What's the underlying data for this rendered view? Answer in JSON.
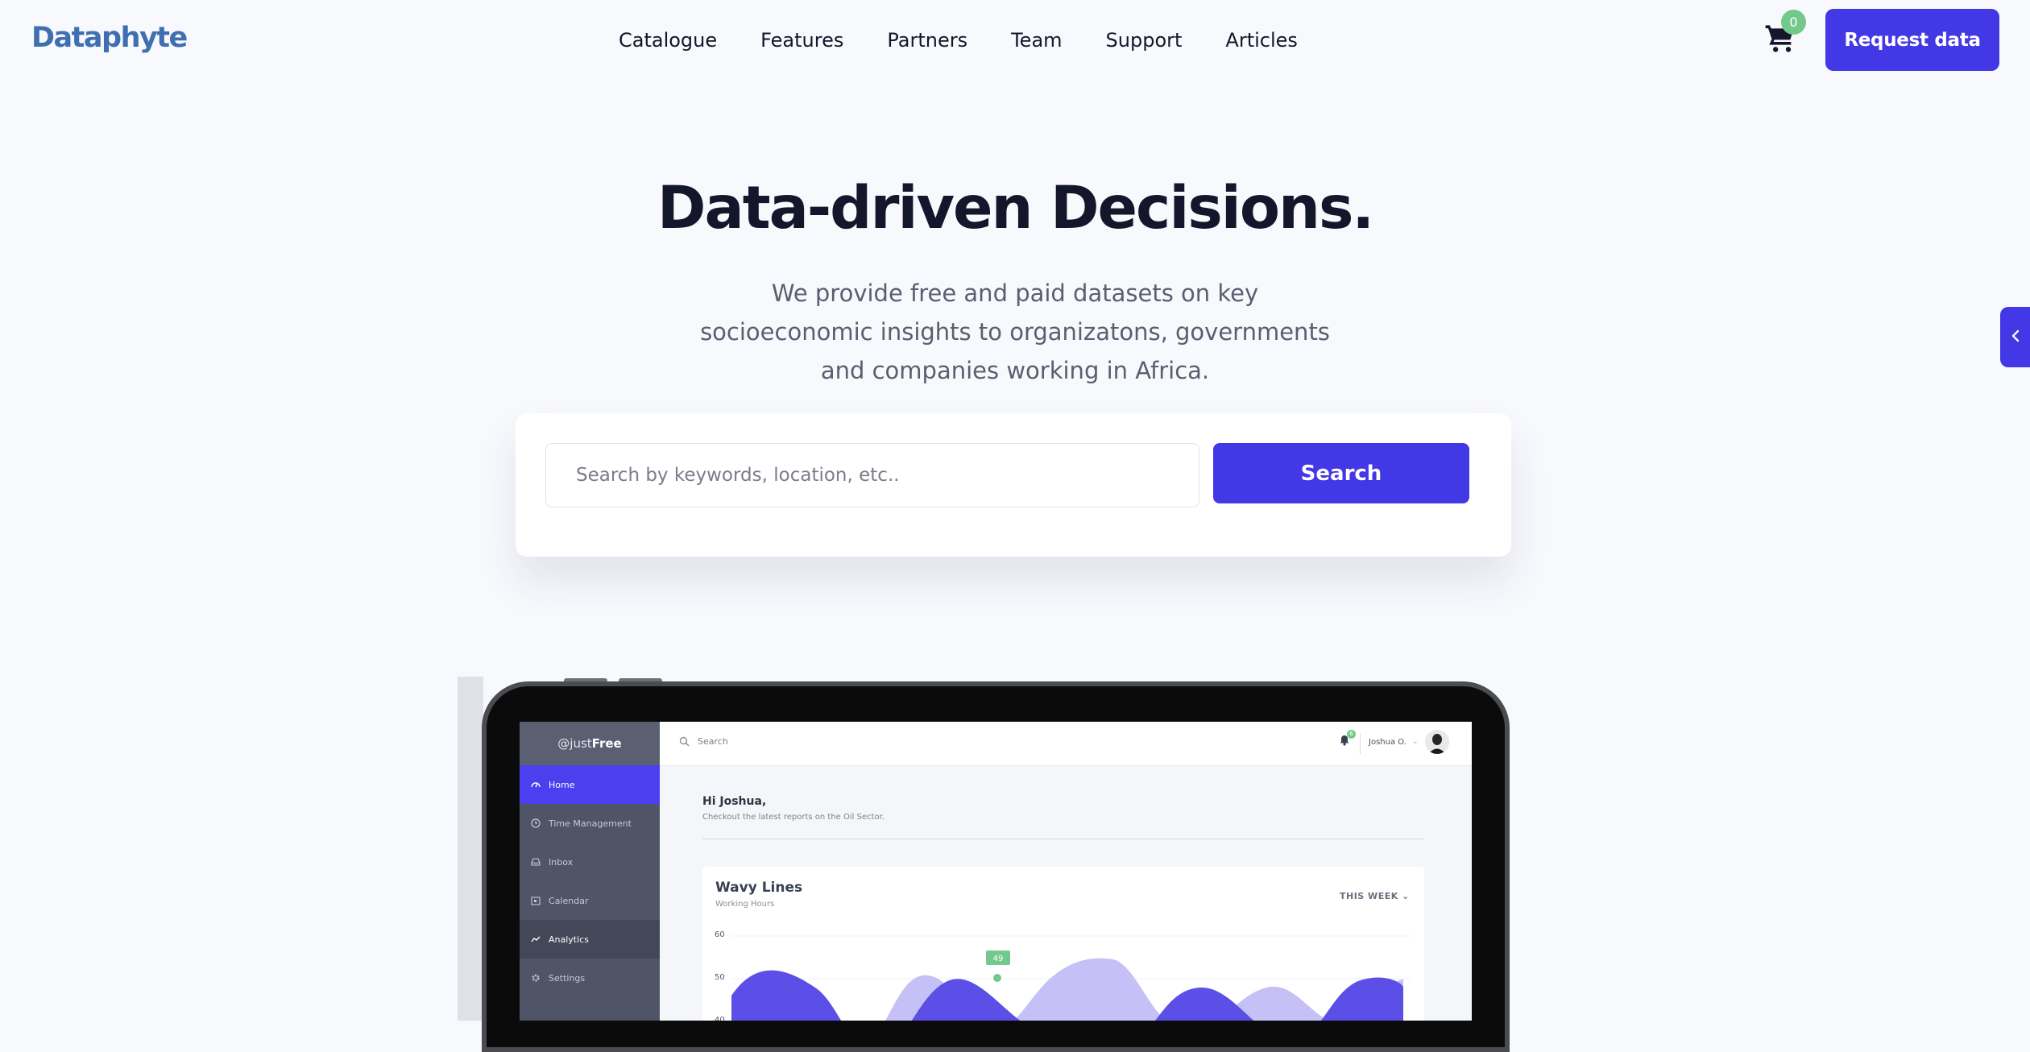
{
  "brand": {
    "logo": "Dataphyte"
  },
  "nav": {
    "items": [
      "Catalogue",
      "Features",
      "Partners",
      "Team",
      "Support",
      "Articles"
    ],
    "cart_count": "0",
    "request_label": "Request data"
  },
  "hero": {
    "title": "Data-driven Decisions.",
    "subtitle": "We provide free and paid datasets on key socioeconomic insights to organizatons, governments and companies working in Africa.",
    "search_placeholder": "Search by keywords, location, etc..",
    "search_button": "Search"
  },
  "mockup": {
    "brand_prefix": "@just",
    "brand_bold": "Free",
    "sidebar": [
      "Home",
      "Time Management",
      "Inbox",
      "Calendar",
      "Analytics",
      "Settings"
    ],
    "search_placeholder": "Search",
    "bell_count": "6",
    "user_name": "Joshua O.",
    "greeting": "Hi Joshua,",
    "greeting_sub": "Checkout the latest reports on the Oil Sector.",
    "card_title": "Wavy Lines",
    "card_subtitle": "Working Hours",
    "card_filter": "THIS WEEK",
    "y_ticks": [
      "60",
      "50",
      "40"
    ],
    "marker_label": "49"
  },
  "colors": {
    "accent": "#4338e6",
    "badge": "#73c98b",
    "wave_dark": "#5b4fe8",
    "wave_light": "#c5c0f5"
  }
}
